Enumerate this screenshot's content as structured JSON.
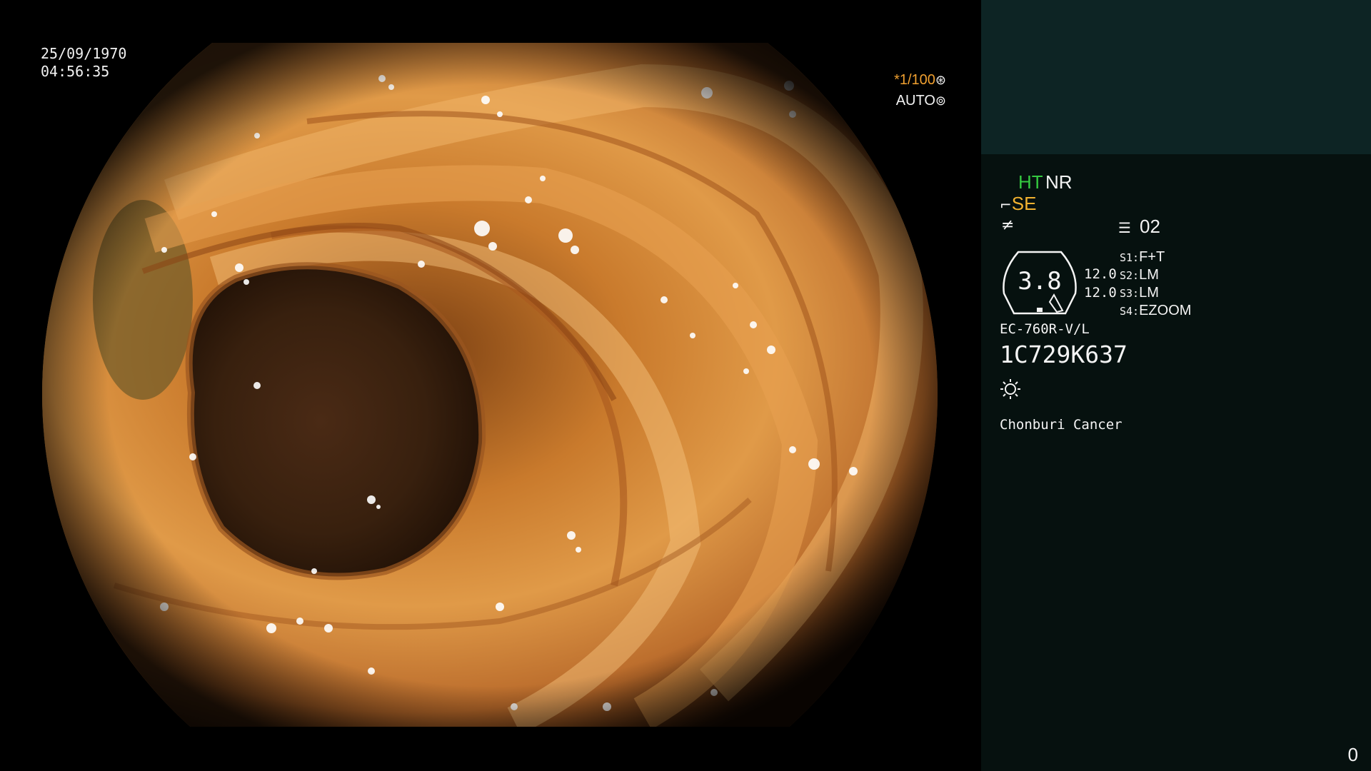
{
  "overlay": {
    "date": "25/09/1970",
    "time": "04:56:35",
    "shutter_speed": "*1/100",
    "shutter_icon": "aperture-icon",
    "exposure_mode": "AUTO",
    "exposure_icon": "iris-icon"
  },
  "panel": {
    "mode_primary": "HT",
    "mode_secondary": "NR",
    "se_icon": "scope-tip-icon",
    "se_label": "SE",
    "freeze_icon": "freeze-icon",
    "memo_icon": "memo-icon",
    "memo_value": "02",
    "gauge_value": "3.8",
    "gauge_reading_1": "12.0",
    "gauge_reading_2": "12.0",
    "switches": [
      {
        "key": "S1:",
        "value": "F+T"
      },
      {
        "key": "S2:",
        "value": "LM"
      },
      {
        "key": "S3:",
        "value": "LM"
      },
      {
        "key": "S4:",
        "value": "EZOOM"
      }
    ],
    "scope_model": "EC-760R-V/L",
    "serial": "1C729K637",
    "light_icon": "light-source-icon",
    "institution": "Chonburi Cancer",
    "counter": "0"
  },
  "colors": {
    "panel_bg": "#06110f",
    "panel_top": "#0d2424",
    "mode_green": "#35c940",
    "se_amber": "#f2b230",
    "shutter_orange": "#f0a030",
    "mucosa": "#c8772a",
    "lumen": "#3a1f0f"
  }
}
